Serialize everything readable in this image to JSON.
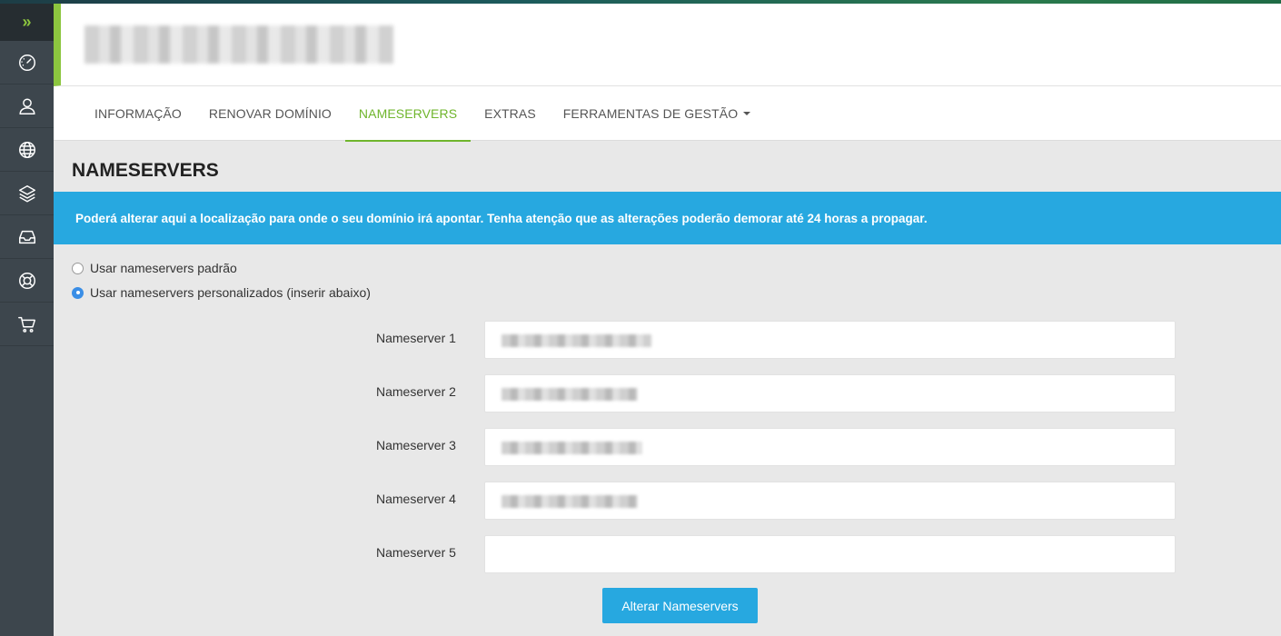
{
  "sidebar": {
    "toggle_glyph": "»",
    "items": [
      {
        "icon": "dashboard-icon"
      },
      {
        "icon": "user-icon"
      },
      {
        "icon": "globe-icon"
      },
      {
        "icon": "layers-icon"
      },
      {
        "icon": "inbox-icon"
      },
      {
        "icon": "support-icon"
      },
      {
        "icon": "cart-icon"
      }
    ]
  },
  "tabs": {
    "info": "INFORMAÇÃO",
    "renew": "RENOVAR DOMÍNIO",
    "nameservers": "NAMESERVERS",
    "extras": "EXTRAS",
    "tools": "FERRAMENTAS DE GESTÃO"
  },
  "page_title": "NAMESERVERS",
  "info_message": "Poderá alterar aqui a localização para onde o seu domínio irá apontar. Tenha atenção que as alterações poderão demorar até 24 horas a propagar.",
  "options": {
    "default_label": "Usar nameservers padrão",
    "custom_label": "Usar nameservers personalizados (inserir abaixo)",
    "selected": "custom"
  },
  "nameservers": {
    "ns1_label": "Nameserver 1",
    "ns2_label": "Nameserver 2",
    "ns3_label": "Nameserver 3",
    "ns4_label": "Nameserver 4",
    "ns5_label": "Nameserver 5"
  },
  "submit_label": "Alterar Nameservers",
  "colors": {
    "accent_green": "#8cc63f",
    "info_blue": "#27a8e0",
    "sidebar": "#3d464d"
  }
}
